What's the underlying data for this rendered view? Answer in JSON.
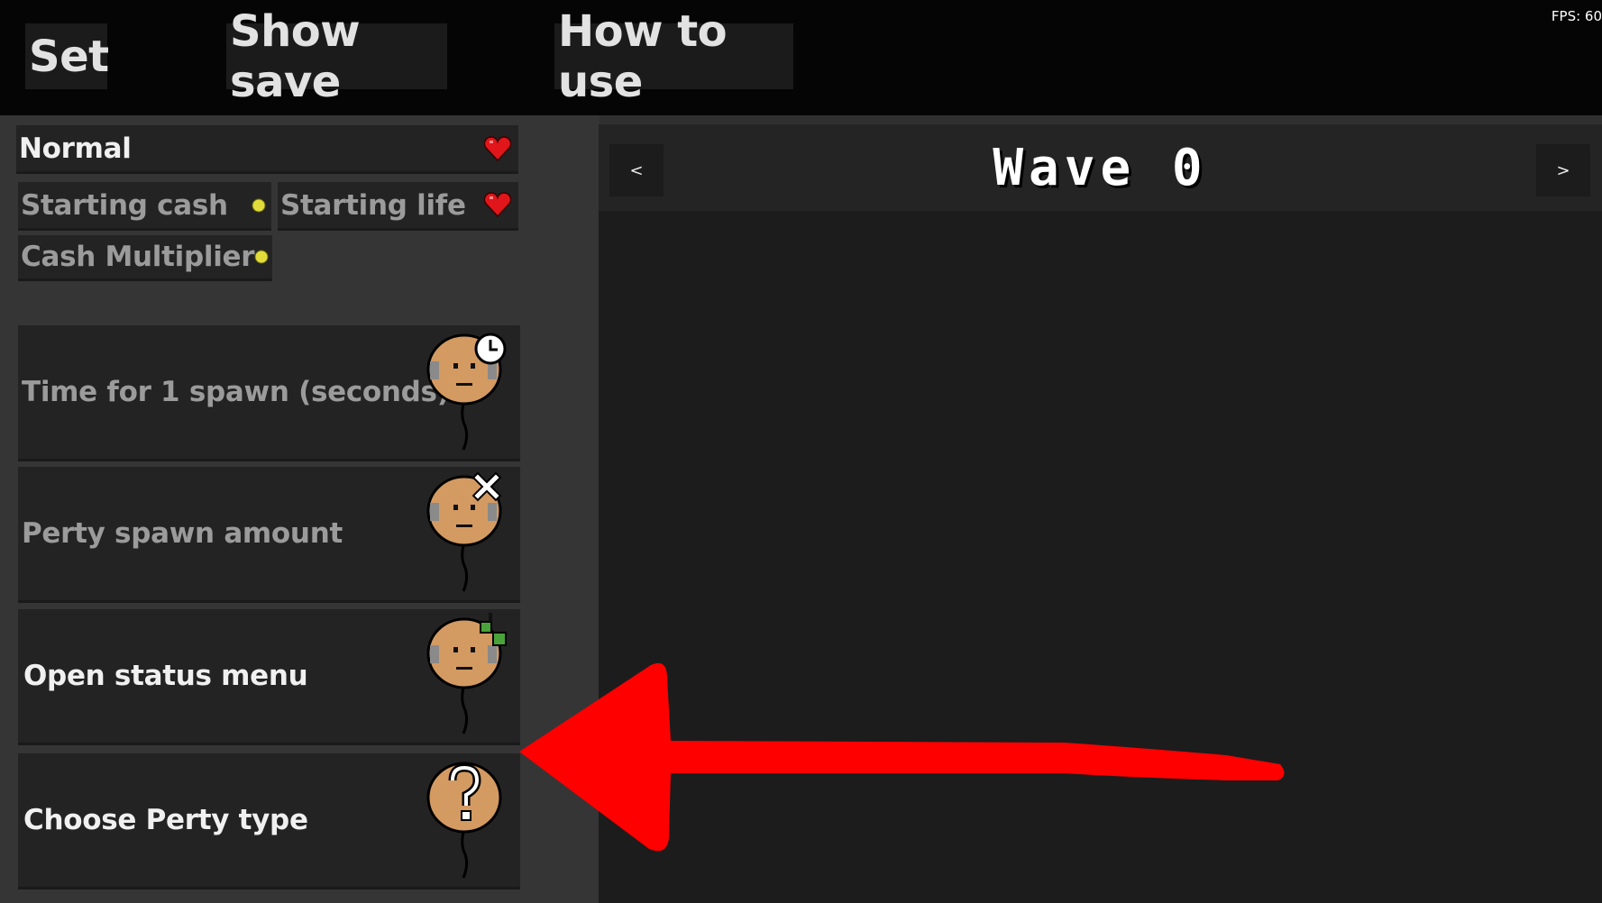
{
  "topbar": {
    "set_label": "Set",
    "show_save_label": "Show save",
    "how_to_use_label": "How to use",
    "fps_text": "FPS: 60"
  },
  "settings": {
    "difficulty_label": "Normal",
    "starting_cash_label": "Starting cash",
    "starting_life_label": "Starting life",
    "cash_multiplier_label": "Cash Multiplier"
  },
  "perty_buttons": [
    {
      "label": "Time for 1 spawn (seconds)",
      "icon": "clock-balloon-icon"
    },
    {
      "label": "Perty spawn amount",
      "icon": "x-balloon-icon"
    },
    {
      "label": "Open status menu",
      "icon": "leaf-balloon-icon"
    },
    {
      "label": "Choose Perty type",
      "icon": "question-balloon-icon"
    }
  ],
  "wave": {
    "title": "Wave 0",
    "prev_label": "<",
    "next_label": ">"
  },
  "colors": {
    "heart": "#e0161b",
    "coin": "#e2dc3a",
    "balloon": "#d39a62",
    "annotation_arrow": "#ff0000"
  }
}
